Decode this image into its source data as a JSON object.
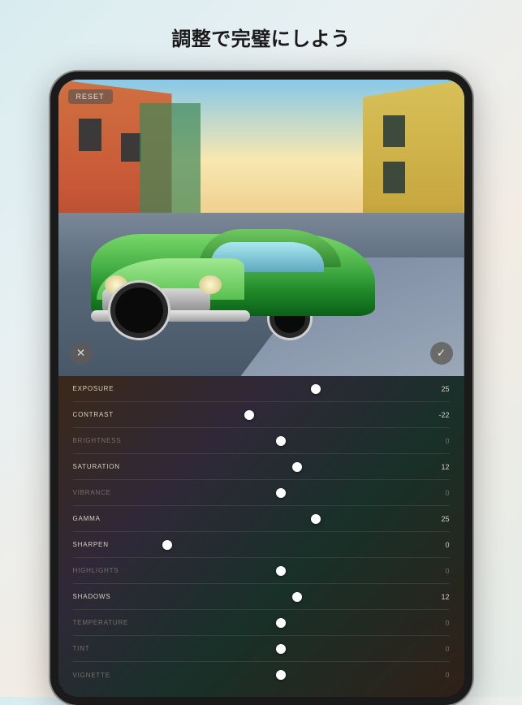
{
  "headline": "調整で完璧にしよう",
  "reset_label": "RESET",
  "icons": {
    "cancel": "✕",
    "confirm": "✓"
  },
  "sliders": [
    {
      "label": "EXPOSURE",
      "value": 25,
      "display": "25",
      "dim": false
    },
    {
      "label": "CONTRAST",
      "value": -22,
      "display": "-22",
      "dim": false
    },
    {
      "label": "BRIGHTNESS",
      "value": 0,
      "display": "0",
      "dim": true
    },
    {
      "label": "SATURATION",
      "value": 12,
      "display": "12",
      "dim": false
    },
    {
      "label": "VIBRANCE",
      "value": 0,
      "display": "0",
      "dim": true
    },
    {
      "label": "GAMMA",
      "value": 25,
      "display": "25",
      "dim": false
    },
    {
      "label": "SHARPEN",
      "value": -80,
      "display": "0",
      "dim": false
    },
    {
      "label": "HIGHLIGHTS",
      "value": 0,
      "display": "0",
      "dim": true
    },
    {
      "label": "SHADOWS",
      "value": 12,
      "display": "12",
      "dim": false
    },
    {
      "label": "TEMPERATURE",
      "value": 0,
      "display": "0",
      "dim": true
    },
    {
      "label": "TINT",
      "value": 0,
      "display": "0",
      "dim": true
    },
    {
      "label": "VIGNETTE",
      "value": 0,
      "display": "0",
      "dim": true
    }
  ]
}
